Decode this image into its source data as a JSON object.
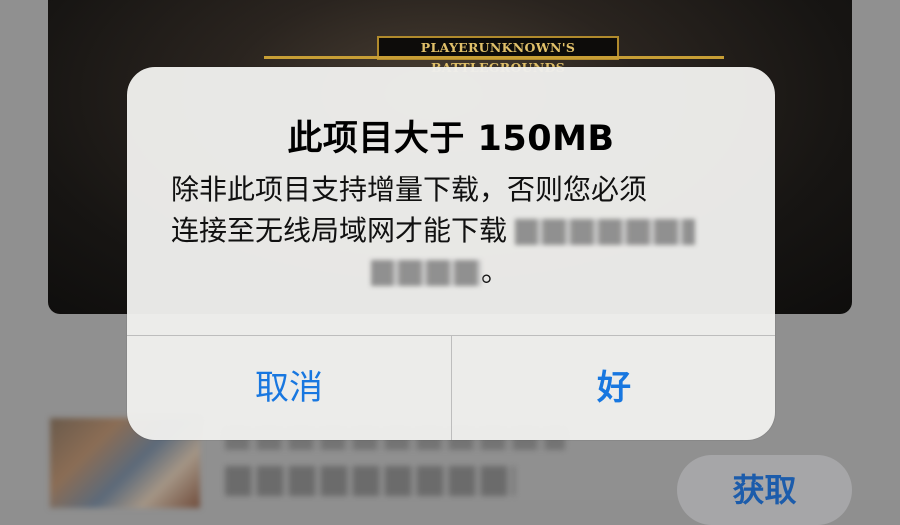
{
  "background": {
    "banner": {
      "logo_text": "PLAYERUNKNOWN'S BATTLEGROUNDS"
    },
    "app_row": {
      "get_button_label": "获取"
    }
  },
  "alert": {
    "title": "此项目大于 150MB",
    "message_line_1": "除非此项目支持增量下载，否则您必须",
    "message_line_2": "连接至无线局域网才能下载",
    "message_end": "。",
    "buttons": {
      "cancel_label": "取消",
      "ok_label": "好"
    }
  },
  "colors": {
    "accent": "#1877e0",
    "alert_background": "#eeeeec"
  }
}
